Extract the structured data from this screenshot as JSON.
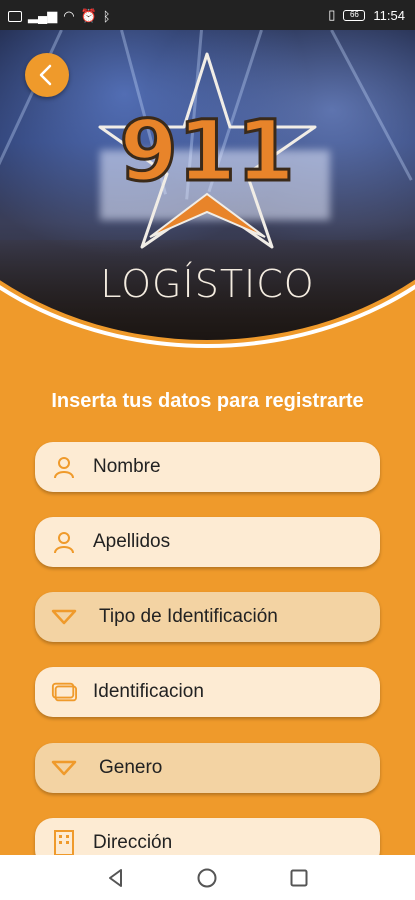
{
  "status_bar": {
    "time": "11:54",
    "battery": "66"
  },
  "header": {
    "logo_number": "911",
    "logo_text": "LOGÍSTICO",
    "back_icon": "chevron-left-icon"
  },
  "form": {
    "heading": "Inserta tus datos para registrarte",
    "fields": [
      {
        "label": "Nombre",
        "icon": "user-icon",
        "type": "input"
      },
      {
        "label": "Apellidos",
        "icon": "user-icon",
        "type": "input"
      },
      {
        "label": "Tipo de Identificación",
        "icon": "chevron-down-icon",
        "type": "select"
      },
      {
        "label": "Identificacion",
        "icon": "id-card-icon",
        "type": "input"
      },
      {
        "label": "Genero",
        "icon": "chevron-down-icon",
        "type": "select"
      },
      {
        "label": "Dirección",
        "icon": "building-icon",
        "type": "input"
      }
    ]
  },
  "nav": {
    "back": "triangle-back-icon",
    "home": "circle-home-icon",
    "recent": "square-recent-icon"
  },
  "colors": {
    "accent": "#ef9a2b",
    "field_bg": "#fdebd3",
    "select_bg": "#f3d3a3"
  }
}
